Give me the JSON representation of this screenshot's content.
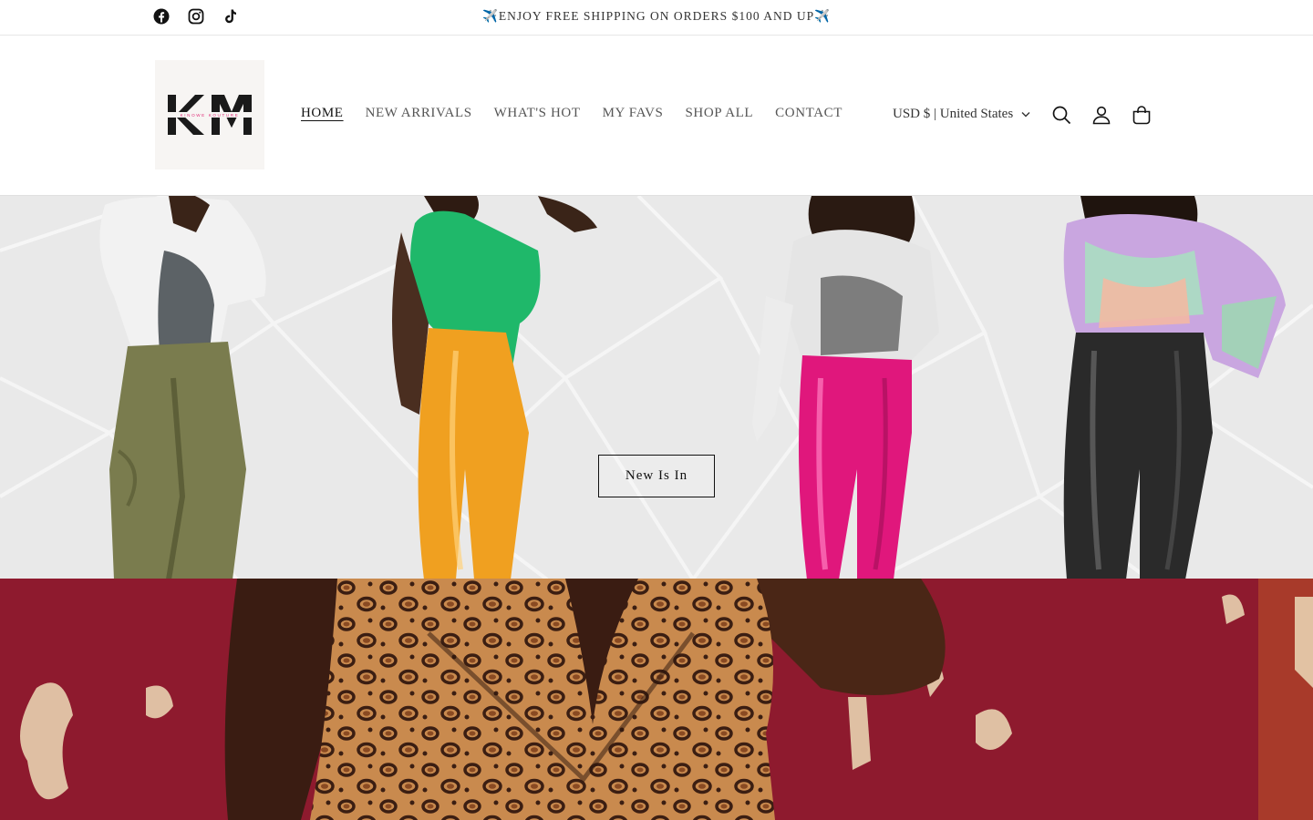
{
  "announcement": {
    "text": "✈️ENJOY FREE SHIPPING ON ORDERS $100 AND UP✈️",
    "social_icons": [
      "facebook-icon",
      "instagram-icon",
      "tiktok-icon"
    ]
  },
  "header": {
    "logo_letters": "KM",
    "logo_tagline": "KINOWE KOUTURE",
    "nav": [
      {
        "label": "HOME",
        "active": true
      },
      {
        "label": "NEW ARRIVALS",
        "active": false
      },
      {
        "label": "WHAT'S HOT",
        "active": false
      },
      {
        "label": "MY FAVS",
        "active": false
      },
      {
        "label": "SHOP ALL",
        "active": false
      },
      {
        "label": "CONTACT",
        "active": false
      }
    ],
    "currency": "USD $ | United States",
    "icons": [
      "search-icon",
      "account-icon",
      "cart-icon"
    ]
  },
  "hero": {
    "button_label": "New Is In"
  },
  "colors": {
    "text": "#121212",
    "accent_pink": "#e0307a",
    "hero_bg": "#e9e9e9",
    "banner_red": "#8e1a2e"
  }
}
